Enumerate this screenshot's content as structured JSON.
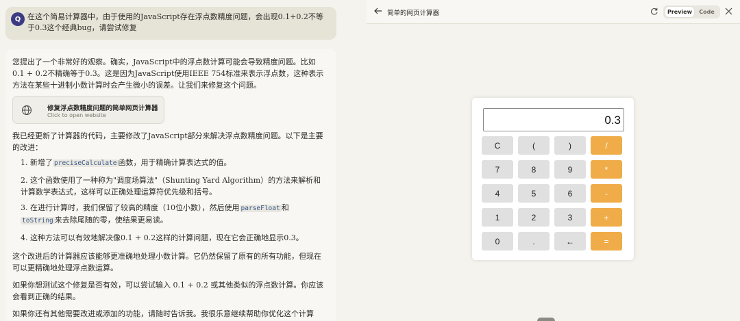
{
  "chat": {
    "user_avatar": "Q",
    "user_message": "在这个简易计算器中，由于使用的JavaScript存在浮点数精度问题，会出现0.1+0.2不等于0.3这个经典bug，请尝试修复",
    "intro": "您提出了一个非常好的观察。确实，JavaScript中的浮点数计算可能会导致精度问题。比如0.1 + 0.2不精确等于0.3。这是因为JavaScript使用IEEE 754标准来表示浮点数，这种表示方法在某些十进制小数计算时会产生微小的误差。让我们来修复这个问题。",
    "artifact": {
      "icon": "globe-icon",
      "title": "修复浮点数精度问题的简单网页计算器",
      "subtitle": "Click to open website"
    },
    "updated": "我已经更新了计算器的代码，主要修改了JavaScript部分来解决浮点数精度问题。以下是主要的改进：",
    "list": [
      {
        "num": "1.",
        "before": "新增了",
        "code": "preciseCalculate",
        "after": "函数，用于精确计算表达式的值。"
      },
      {
        "num": "2.",
        "text": "这个函数使用了一种称为\"调度场算法\"（Shunting Yard Algorithm）的方法来解析和计算数学表达式，这样可以正确处理运算符优先级和括号。"
      },
      {
        "num": "3.",
        "before": "在进行计算时，我们保留了较高的精度（10位小数），然后使用",
        "code": "parseFloat",
        "mid": "和",
        "code2": "toString",
        "after": "来去除尾随的零，使结果更易读。"
      },
      {
        "num": "4.",
        "text": "这种方法可以有效地解决像0.1 + 0.2这样的计算问题，现在它会正确地显示0.3。"
      }
    ],
    "closing1": "这个改进后的计算器应该能够更准确地处理小数计算。它仍然保留了原有的所有功能，但现在可以更精确地处理浮点数运算。",
    "closing2": "如果你想测试这个修复是否有效，可以尝试输入 0.1 + 0.2 或其他类似的浮点数计算。你应该会看到正确的结果。",
    "closing3": "如果你还有其他需要改进或添加的功能，请随时告诉我。我很乐意继续帮助你优化这个计算"
  },
  "panel": {
    "title": "简单的网页计算器",
    "preview_label": "Preview",
    "code_label": "Code",
    "active_tab": "Preview"
  },
  "calculator": {
    "display": "0.3",
    "rows": [
      [
        "C",
        "(",
        ")",
        "/"
      ],
      [
        "7",
        "8",
        "9",
        "*"
      ],
      [
        "4",
        "5",
        "6",
        "-"
      ],
      [
        "1",
        "2",
        "3",
        "+"
      ],
      [
        "0",
        ".",
        "←",
        "="
      ]
    ],
    "operator_color": "#efac48",
    "key_color": "#e0e0e0"
  }
}
